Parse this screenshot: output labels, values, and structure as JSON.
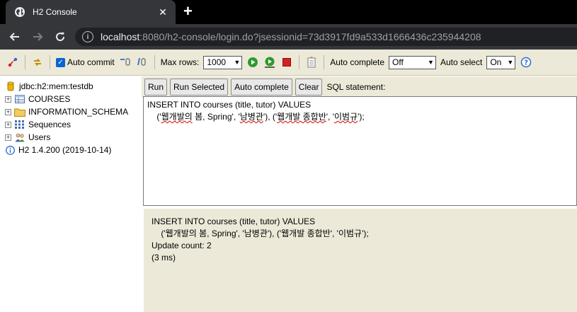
{
  "browser": {
    "tab_title": "H2 Console",
    "close_glyph": "✕",
    "new_tab_glyph": "+",
    "url_host": "localhost",
    "url_rest": ":8080/h2-console/login.do?jsessionid=73d3917fd9a533d1666436c235944208"
  },
  "toolbar": {
    "auto_commit_label": "Auto commit",
    "max_rows_label": "Max rows:",
    "max_rows_value": "1000",
    "auto_complete_label": "Auto complete",
    "auto_complete_value": "Off",
    "auto_select_label": "Auto select",
    "auto_select_value": "On"
  },
  "tree": {
    "connection": "jdbc:h2:mem:testdb",
    "items": [
      {
        "label": "COURSES",
        "icon": "table-icon"
      },
      {
        "label": "INFORMATION_SCHEMA",
        "icon": "folder-icon"
      },
      {
        "label": "Sequences",
        "icon": "sequences-icon"
      },
      {
        "label": "Users",
        "icon": "users-icon"
      }
    ],
    "version": "H2 1.4.200 (2019-10-14)"
  },
  "buttons": {
    "run": "Run",
    "run_selected": "Run Selected",
    "auto_complete": "Auto complete",
    "clear": "Clear",
    "sql_statement_label": "SQL statement:"
  },
  "editor": {
    "line1": "INSERT INTO courses (title, tutor) VALUES",
    "line2_a": "    ('",
    "line2_b": "웹개발의",
    "line2_c": " 봄, Spring', '",
    "line2_d": "남병관",
    "line2_e": "'), ('",
    "line2_f": "웹개발 종합반",
    "line2_g": "', '",
    "line2_h": "이범규",
    "line2_i": "');"
  },
  "output": {
    "line1": "INSERT INTO courses (title, tutor) VALUES",
    "line2": "    ('웹개발의 봄, Spring', '남병관'), ('웹개발 종합반', '이범규');",
    "line3": "Update count: 2",
    "line4": "(3 ms)"
  },
  "colors": {
    "panel_bg": "#ece9d8",
    "browser_dark": "#35363a",
    "run_green": "#2e9a2e",
    "stop_red": "#d52020",
    "checkbox_blue": "#0a64d4"
  }
}
